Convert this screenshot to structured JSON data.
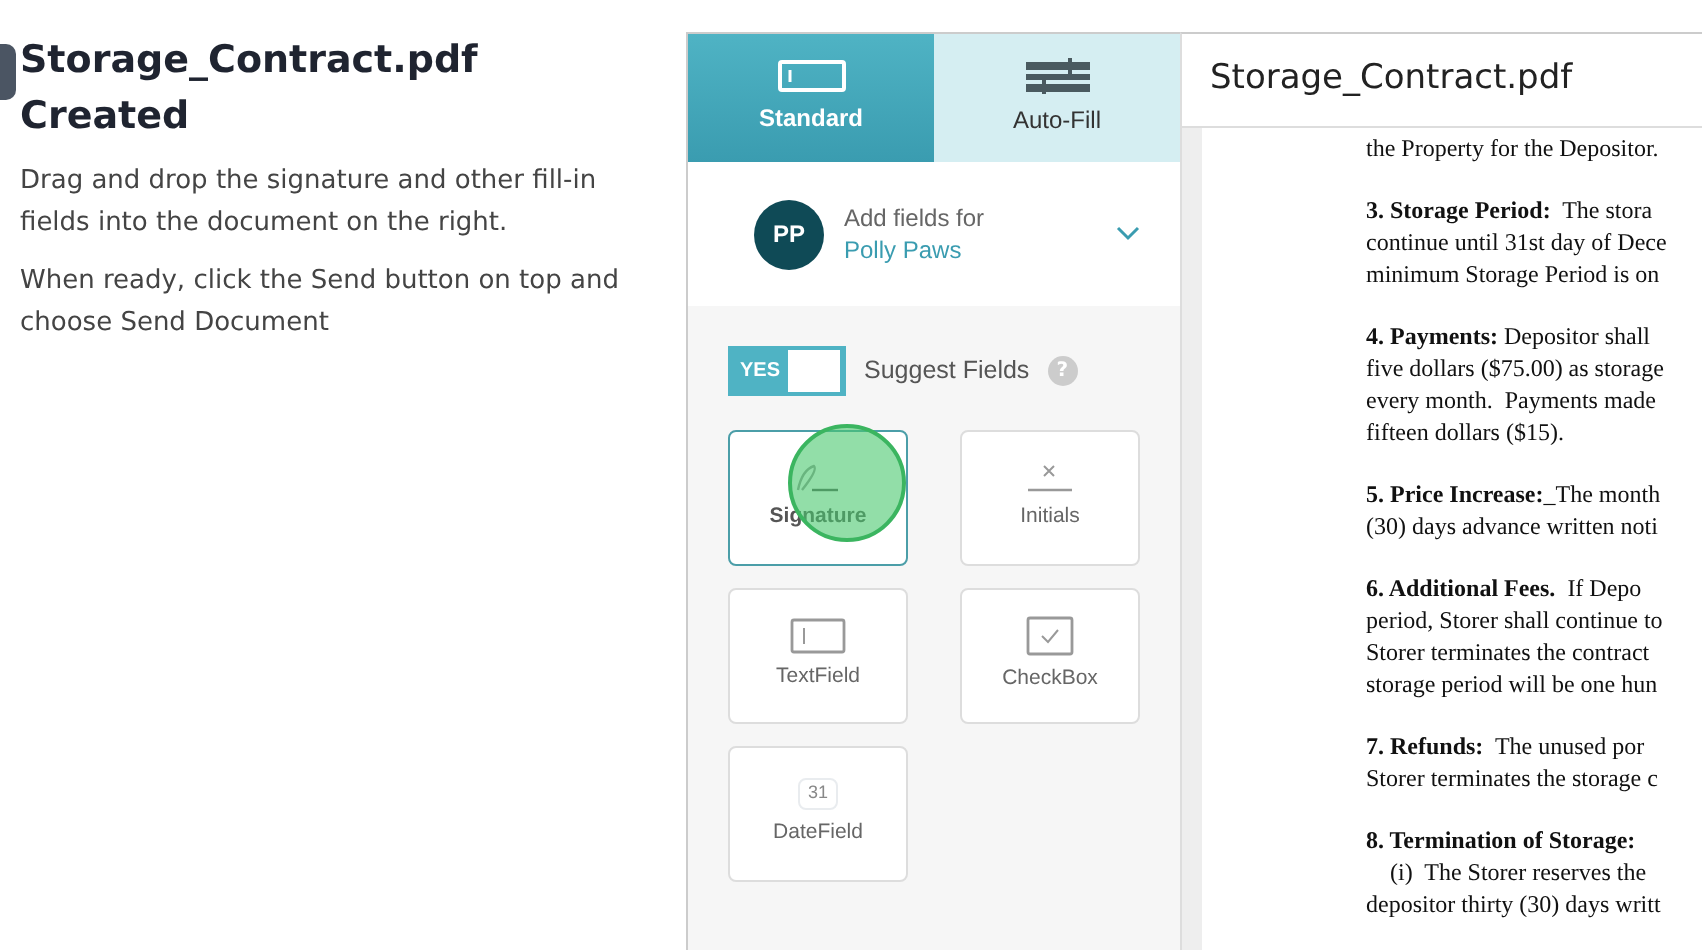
{
  "intro": {
    "title_lines": [
      "Storage_Contract.pdf",
      "Created"
    ],
    "paragraphs": [
      "Drag and drop the signature and other fill-in fields into the document on the right.",
      "When ready, click the Send button on top and choose Send Document"
    ]
  },
  "tabs": [
    {
      "label": "Standard",
      "kind": "standard",
      "selected": true
    },
    {
      "label": "Auto-Fill",
      "kind": "autofill",
      "selected": false
    }
  ],
  "recipient": {
    "initials": "PP",
    "caption": "Add fields for",
    "name": "Polly Paws"
  },
  "suggest": {
    "switch_label": "YES",
    "on": true,
    "label": "Suggest Fields",
    "help": "?"
  },
  "fields": [
    {
      "label": "Signature",
      "kind": "signature",
      "selected": true
    },
    {
      "label": "Initials",
      "kind": "initials",
      "selected": false
    },
    {
      "label": "TextField",
      "kind": "textfield",
      "selected": false
    },
    {
      "label": "CheckBox",
      "kind": "checkbox",
      "selected": false
    },
    {
      "label": "DateField",
      "kind": "datefield",
      "selected": false,
      "icon_text": "31"
    }
  ],
  "document": {
    "title": "Storage_Contract.pdf",
    "paragraphs": [
      [
        "the Property for the Depositor."
      ],
      [
        "**3. Storage Period:**  The stora",
        "continue until 31st day of Dece",
        "minimum Storage Period is on"
      ],
      [
        "**4. Payments:** Depositor shall",
        "five dollars ($75.00) as storage",
        "every month.  Payments made",
        "fifteen dollars ($15)."
      ],
      [
        "**5. Price Increase:**_The month",
        "(30) days advance written noti"
      ],
      [
        "**6. Additional Fees.**  If Depo",
        "period, Storer shall continue to",
        "Storer terminates the contract",
        "storage period will be one hun"
      ],
      [
        "**7. Refunds:**  The unused por",
        "Storer terminates the storage c"
      ],
      [
        "**8. Termination of Storage:**",
        "    (i)  The Storer reserves the",
        "depositor thirty (30) days writt"
      ]
    ]
  }
}
